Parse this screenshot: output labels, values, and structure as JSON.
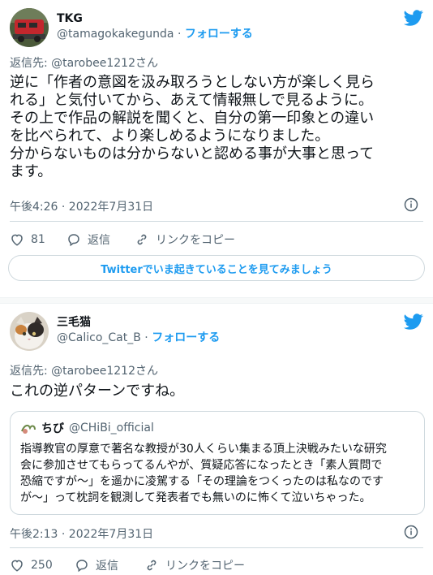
{
  "tweets": [
    {
      "display_name": "TKG",
      "handle": "@tamagokakegunda",
      "separator": " · ",
      "follow_label": "フォローする",
      "reply_label": "返信先: @tarobee1212さん",
      "text": "逆に「作者の意図を汲み取ろうとしない方が楽しく見ら\nれる」と気付いてから、あえて情報無しで見るように。\nその上で作品の解説を聞くと、自分の第一印象との違い\nを比べられて、より楽しめるようになりました。\n分からないものは分からないと認める事が大事と思って\nます。",
      "timestamp": "午後4:26 · 2022年7月31日",
      "likes": "81",
      "reply_action": "返信",
      "copy_link": "リンクをコピー",
      "cta_label": "Twitterでいま起きていることを見てみましょう"
    },
    {
      "display_name": "三毛猫",
      "handle": "@Calico_Cat_B",
      "separator": " · ",
      "follow_label": "フォローする",
      "reply_label": "返信先: @tarobee1212さん",
      "text": "これの逆パターンですね。",
      "quote": {
        "name": "ちび",
        "handle": "@CHiBi_official",
        "text": "指導教官の厚意で著名な教授が30人くらい集まる頂上決戦みたいな研究\n会に参加させてもらってるんやが、質疑応答になったとき「素人質問で\n恐縮ですが〜」を遥かに凌駕する「その理論をつくったのは私なのです\nが〜」って枕詞を観測して発表者でも無いのに怖くて泣いちゃった。"
      },
      "timestamp": "午後2:13 · 2022年7月31日",
      "likes": "250",
      "reply_action": "返信",
      "copy_link": "リンクをコピー"
    }
  ],
  "colors": {
    "accent": "#1d9bf0",
    "secondary_text": "#536471",
    "border": "#cfd9de"
  }
}
